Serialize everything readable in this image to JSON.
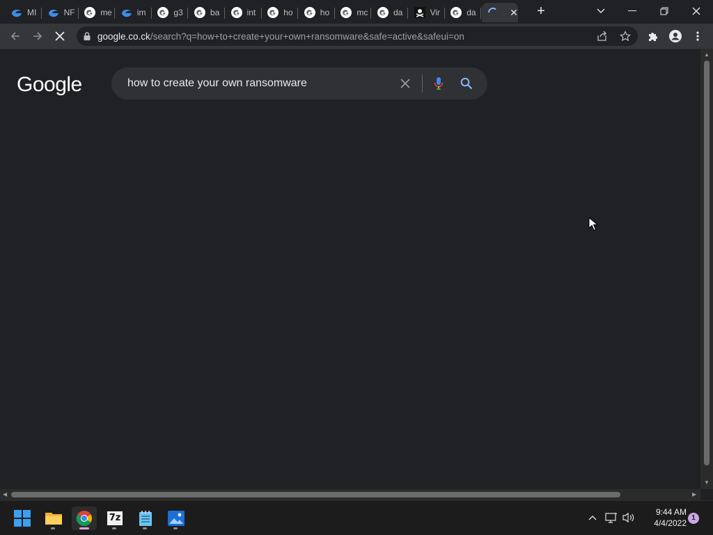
{
  "browser": {
    "tabs": [
      {
        "title": "MI",
        "favicon": "edge-blue-icon"
      },
      {
        "title": "NF",
        "favicon": "edge-blue-icon"
      },
      {
        "title": "me",
        "favicon": "google-g-icon"
      },
      {
        "title": "im",
        "favicon": "edge-blue-icon"
      },
      {
        "title": "g3",
        "favicon": "google-g-icon"
      },
      {
        "title": "ba",
        "favicon": "google-g-icon"
      },
      {
        "title": "int",
        "favicon": "google-g-icon"
      },
      {
        "title": "ho",
        "favicon": "google-g-icon"
      },
      {
        "title": "ho",
        "favicon": "google-g-icon"
      },
      {
        "title": "mc",
        "favicon": "google-g-icon"
      },
      {
        "title": "da",
        "favicon": "google-g-icon"
      },
      {
        "title": "Vir",
        "favicon": "pirate-flag-icon"
      },
      {
        "title": "da",
        "favicon": "google-g-icon"
      }
    ],
    "active_tab": {
      "title": "",
      "favicon": "loading-spinner-icon"
    },
    "url_host": "google.co.ck",
    "url_path": "/search?q=how+to+create+your+own+ransomware&safe=active&safeui=on"
  },
  "google": {
    "logo": "Google",
    "query": "how to create your own ransomware"
  },
  "taskbar": {
    "time": "9:44 AM",
    "date": "4/4/2022",
    "notification_count": "1",
    "sevenzip_label": "7z"
  },
  "colors": {
    "page_bg": "#202124",
    "toolbar_bg": "#35363a",
    "search_bg": "#303134",
    "accent_blue": "#8ab4f8",
    "taskbar_bg": "#1c1c1c"
  }
}
